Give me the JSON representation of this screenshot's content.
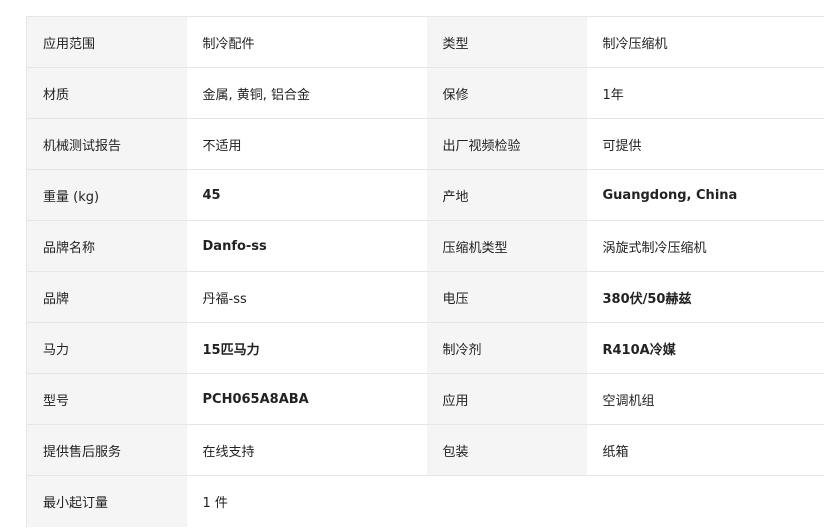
{
  "spec_table": {
    "rows": [
      {
        "label1": "应用范围",
        "value1": "制冷配件",
        "label2": "类型",
        "value2": "制冷压缩机"
      },
      {
        "label1": "材质",
        "value1": "金属, 黄铜, 铝合金",
        "label2": "保修",
        "value2": "1年"
      },
      {
        "label1": "机械测试报告",
        "value1": "不适用",
        "label2": "出厂视频检验",
        "value2": "可提供"
      },
      {
        "label1": "重量 (kg)",
        "value1": "45",
        "label2": "产地",
        "value2": "Guangdong, China"
      },
      {
        "label1": "品牌名称",
        "value1": "Danfo-ss",
        "label2": "压缩机类型",
        "value2": "涡旋式制冷压缩机"
      },
      {
        "label1": "品牌",
        "value1": "丹福-ss",
        "label2": "电压",
        "value2": "380伏/50赫兹"
      },
      {
        "label1": "马力",
        "value1": "15匹马力",
        "label2": "制冷剂",
        "value2": "R410A冷媒"
      },
      {
        "label1": "型号",
        "value1": "PCH065A8ABA",
        "label2": "应用",
        "value2": "空调机组"
      },
      {
        "label1": "提供售后服务",
        "value1": "在线支持",
        "label2": "包装",
        "value2": "纸箱"
      },
      {
        "label1": "最小起订量",
        "value1": "1 件"
      }
    ]
  },
  "colors": {
    "label_bg": "#f5f5f5",
    "value_bg": "#ffffff",
    "border": "#e6e6e6",
    "text": "#222222"
  }
}
